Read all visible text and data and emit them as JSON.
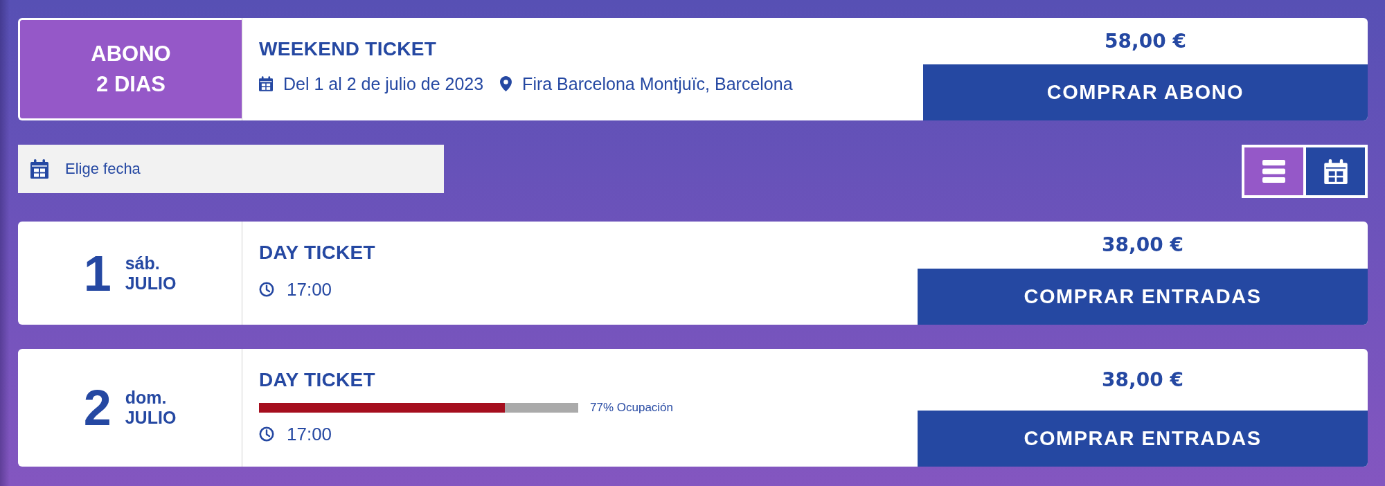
{
  "pass": {
    "label": "ABONO 2 DIAS",
    "title": "WEEKEND TICKET",
    "dates": "Del 1 al 2 de julio de 2023",
    "venue": "Fira Barcelona Montjuïc, Barcelona",
    "price": "58,00 €",
    "button": "COMPRAR ABONO"
  },
  "date_filter": {
    "placeholder": "Elige fecha"
  },
  "view_toggle": [
    {
      "kind": "list",
      "selected": true
    },
    {
      "kind": "calendar",
      "selected": false
    }
  ],
  "sessions": [
    {
      "day": "1",
      "weekday": "sáb.",
      "month": "JULIO",
      "title": "DAY TICKET",
      "time": "17:00",
      "price": "38,00 €",
      "button": "COMPRAR ENTRADAS"
    },
    {
      "day": "2",
      "weekday": "dom.",
      "month": "JULIO",
      "title": "DAY TICKET",
      "occupancy": {
        "level": 0.77,
        "reading": "77% Ocupación"
      },
      "time": "17:00",
      "price": "38,00 €",
      "button": "COMPRAR ENTRADAS"
    }
  ]
}
